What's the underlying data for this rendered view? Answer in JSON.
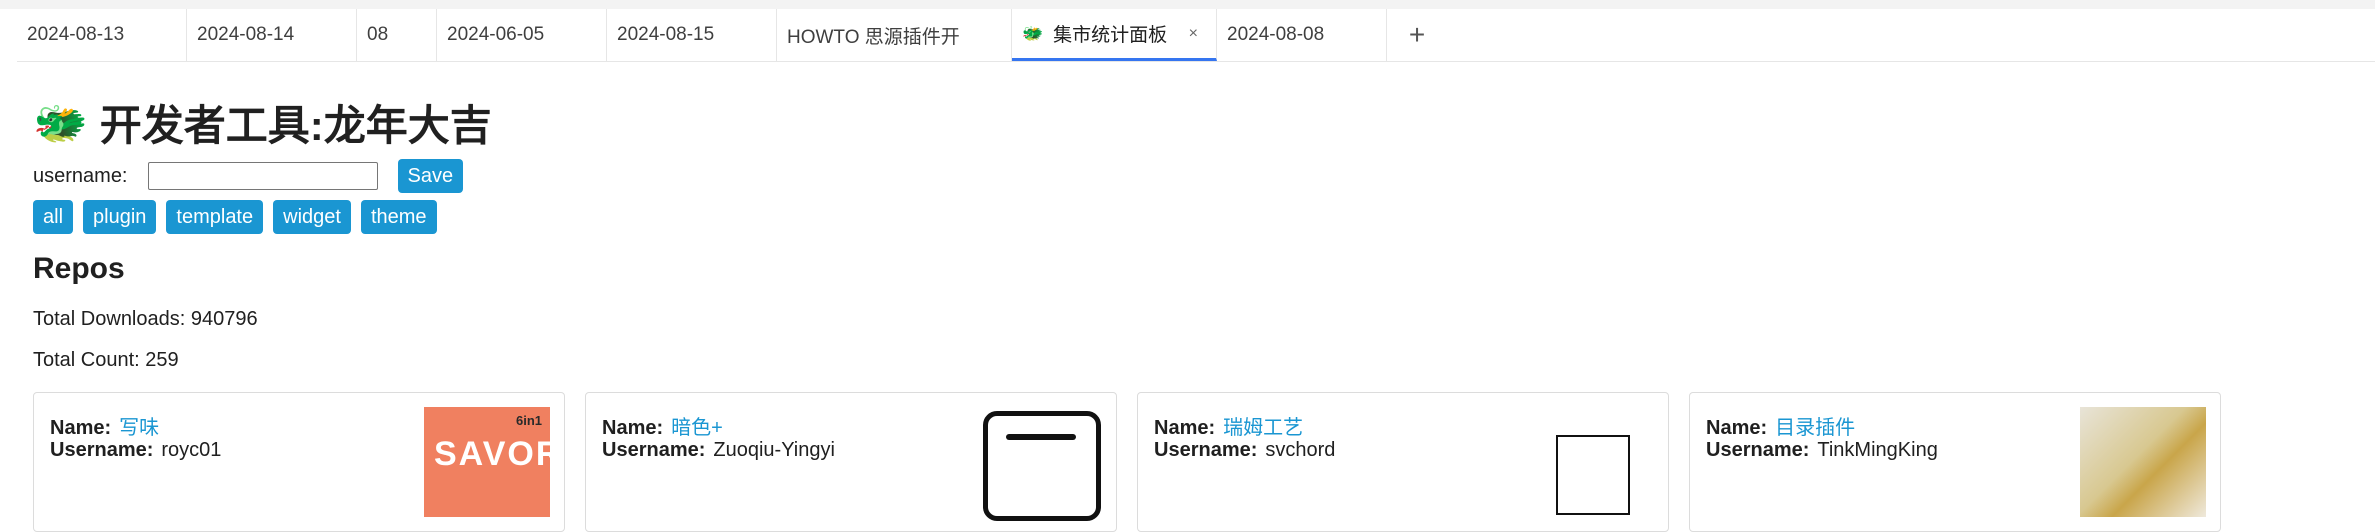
{
  "tabs": [
    {
      "label": "2024-08-13",
      "icon": "",
      "active": false
    },
    {
      "label": "2024-08-14",
      "icon": "",
      "active": false
    },
    {
      "label": "08",
      "icon": "",
      "active": false
    },
    {
      "label": "2024-06-05",
      "icon": "",
      "active": false
    },
    {
      "label": "2024-08-15",
      "icon": "",
      "active": false
    },
    {
      "label": "HOWTO 思源插件开",
      "icon": "",
      "active": false
    },
    {
      "label": "集市统计面板",
      "icon": "🐲",
      "active": true,
      "close": "×"
    },
    {
      "label": "2024-08-08",
      "icon": "",
      "active": false
    }
  ],
  "tab_add": "+",
  "title": {
    "logo": "🐲",
    "text": "开发者工具:龙年大吉"
  },
  "user": {
    "label": "username:",
    "value": "",
    "placeholder": "",
    "save": "Save"
  },
  "filters": [
    "all",
    "plugin",
    "template",
    "widget",
    "theme"
  ],
  "repos": {
    "heading": "Repos",
    "total_downloads": "Total Downloads: 940796",
    "total_count": "Total Count: 259"
  },
  "cards": [
    {
      "name_label": "Name:",
      "name": "写味",
      "username_label": "Username:",
      "username": "royc01",
      "thumb_small": "6in1",
      "thumb_big": "SAVOR"
    },
    {
      "name_label": "Name:",
      "name": "暗色+",
      "username_label": "Username:",
      "username": "Zuoqiu-Yingyi"
    },
    {
      "name_label": "Name:",
      "name": "瑞姆工艺",
      "username_label": "Username:",
      "username": "svchord"
    },
    {
      "name_label": "Name:",
      "name": "目录插件",
      "username_label": "Username:",
      "username": "TinkMingKing"
    }
  ],
  "colors": {
    "accent": "#1a96d2",
    "active_tab_underline": "#3575f0"
  }
}
